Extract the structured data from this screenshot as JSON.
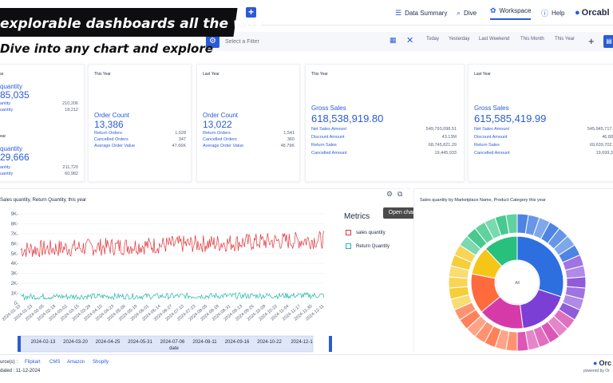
{
  "topbar": {
    "search_placeholder": "Ask any data question",
    "plus": "+",
    "nav": [
      {
        "label": "Data Summary",
        "icon": "list-icon"
      },
      {
        "label": "Dive",
        "icon": "search-icon"
      },
      {
        "label": "Workspace",
        "icon": "workspace-icon"
      },
      {
        "label": "Help",
        "icon": "help-icon"
      }
    ],
    "brand": "Orcabl",
    "brand_color": "#2a5bd7"
  },
  "banner": {
    "line1": "explorable  dashboards all the way",
    "line2": "Dive into any chart and explore"
  },
  "filterbar": {
    "placeholder": "Select a Filter",
    "chips": [
      "Today",
      "Yesterday",
      "Last Weekend",
      "This Month",
      "This Year"
    ],
    "add": "+"
  },
  "cards": [
    {
      "period": "ar",
      "title": "quantity",
      "big": "85,035",
      "rows": [
        {
          "k": "antity",
          "v": "210,206"
        },
        {
          "k": "uantity",
          "v": "18,212"
        }
      ]
    },
    {
      "period": "ear",
      "title": "quantity",
      "big": "29,666",
      "rows": [
        {
          "k": "antity",
          "v": "211,720"
        },
        {
          "k": "uantity",
          "v": "60,982"
        }
      ]
    },
    {
      "period": "This Year",
      "title": "Order Count",
      "big": "13,386",
      "rows": [
        {
          "k": "Return Orders",
          "v": "1,528"
        },
        {
          "k": "Cancelled Orders",
          "v": "347"
        },
        {
          "k": "Average Order Value",
          "v": "47.66K"
        }
      ]
    },
    {
      "period": "Last Year",
      "title": "Order Count",
      "big": "13,022",
      "rows": [
        {
          "k": "Return Orders",
          "v": "1,541"
        },
        {
          "k": "Cancelled Orders",
          "v": "360"
        },
        {
          "k": "Average Order Value",
          "v": "48.79K"
        }
      ]
    },
    {
      "period": "This Year",
      "title": "Gross Sales",
      "big": "618,538,919.80",
      "rows": [
        {
          "k": "Net Sales Amount",
          "v": "549,793,098.51"
        },
        {
          "k": "Discount Amount",
          "v": "43.13M"
        },
        {
          "k": "Return Sales",
          "v": "68,745,821.29"
        },
        {
          "k": "Cancelled Amount",
          "v": "19,445,933"
        }
      ]
    },
    {
      "period": "Last Year",
      "title": "Gross Sales",
      "big": "615,585,419.99",
      "rows": [
        {
          "k": "Net Sales Amount",
          "v": "545,945,717."
        },
        {
          "k": "Discount Amount",
          "v": "46.88"
        },
        {
          "k": "Return Sales",
          "v": "69,639,702."
        },
        {
          "k": "Cancelled Amount",
          "v": "19,699,3"
        }
      ]
    }
  ],
  "line_panel": {
    "title": "Sales quantity, Return Quantity, this year",
    "tooltip": "Open chart",
    "legend_title": "Metrics",
    "legend": [
      {
        "label": "sales quantity",
        "color": "#e0353b"
      },
      {
        "label": "Return Quantity",
        "color": "#22b8a6"
      }
    ],
    "navigator_label": "date"
  },
  "sun_panel": {
    "title": "Sales quantity by Marketplace Name, Product Category this year",
    "center_label": "All"
  },
  "chart_data": [
    {
      "type": "line",
      "title": "Sales quantity, Return Quantity, this year",
      "xlabel": "date",
      "ylabel": "",
      "y_ticks": [
        "9K-",
        "8K-",
        "7K-",
        "6K-",
        "5K-",
        "4K-",
        "3K-",
        "2K-",
        "1K-",
        "0-"
      ],
      "ylim": [
        0,
        9000
      ],
      "x_ticks": [
        "2024-01-10",
        "2024-01-23",
        "2024-02-05",
        "2024-02-18",
        "2024-03-02",
        "2024-03-15",
        "2024-03-28",
        "2024-04-10",
        "2024-04-23",
        "2024-05-06",
        "2024-05-19",
        "2024-06-01",
        "2024-06-14",
        "2024-06-27",
        "2024-07-10",
        "2024-07-23",
        "2024-08-05",
        "2024-08-18",
        "2024-08-31",
        "2024-09-13",
        "2024-09-26",
        "2024-10-09",
        "2024-10-22",
        "2024-11-04",
        "2024-11-17",
        "2024-11-30",
        "2024-12-11"
      ],
      "navigator_ticks": [
        "2024-02-13",
        "2024-03-20",
        "2024-04-25",
        "2024-05-31",
        "2024-07-06",
        "2024-08-11",
        "2024-09-16",
        "2024-10-22",
        "2024-12-1"
      ],
      "series": [
        {
          "name": "sales quantity",
          "color": "#e0353b",
          "level_start": 5400,
          "level_end": 6400,
          "amplitude": 900
        },
        {
          "name": "Return Quantity",
          "color": "#22b8a6",
          "level_start": 650,
          "level_end": 780,
          "amplitude": 300
        }
      ],
      "grid": true,
      "legend": "right"
    },
    {
      "type": "sunburst",
      "title": "Sales quantity by Marketplace Name, Product Category this year",
      "inner": [
        {
          "name": "",
          "value": 30,
          "color": "#2e6fe0"
        },
        {
          "name": "",
          "value": 18,
          "color": "#7c3fd6"
        },
        {
          "name": "",
          "value": 16,
          "color": "#d63aa8"
        },
        {
          "name": "",
          "value": 14,
          "color": "#ff6b3d"
        },
        {
          "name": "",
          "value": 10,
          "color": "#f5c518"
        },
        {
          "name": "",
          "value": 12,
          "color": "#27c07d"
        }
      ],
      "outer_segments": 38,
      "legend": "none"
    }
  ],
  "footer": {
    "source_label": "urce(s) :",
    "sources": [
      "Flipkart",
      "CMS",
      "Amazon",
      "Shopify"
    ],
    "updated": "dated : 11-12-2024",
    "brand": "Orc",
    "powered": "powered by Or"
  }
}
